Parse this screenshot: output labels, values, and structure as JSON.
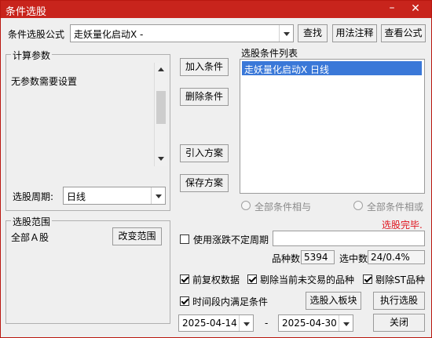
{
  "window": {
    "title": "条件选股",
    "min_glyph": "–",
    "close_glyph": "✕"
  },
  "formula": {
    "label": "条件选股公式",
    "value": "走妖量化启动X  -"
  },
  "buttons": {
    "find": "查找",
    "usage": "用法注释",
    "view_formula": "查看公式",
    "add_condition": "加入条件",
    "delete_condition": "删除条件",
    "import_plan": "引入方案",
    "save_plan": "保存方案",
    "change_range": "改变范围",
    "to_block": "选股入板块",
    "execute": "执行选股",
    "close": "关闭"
  },
  "params": {
    "group_title": "计算参数",
    "text": "无参数需要设置"
  },
  "period": {
    "label": "选股周期:",
    "value": "日线"
  },
  "condition_list": {
    "title": "选股条件列表",
    "items": [
      "走妖量化启动X  日线"
    ]
  },
  "logic": {
    "all_and": "全部条件相与",
    "all_or": "全部条件相或"
  },
  "status": {
    "text": "选股完毕.",
    "color": "#e0141e"
  },
  "range": {
    "group_title": "选股范围",
    "value": "全部Ａ股"
  },
  "uncertain_period": {
    "label": "使用涨跌不定周期",
    "checked": false,
    "value": ""
  },
  "stats": {
    "count_label": "品种数",
    "count_value": "5394",
    "hit_label": "选中数",
    "hit_value": "24/0.4%"
  },
  "options": {
    "fq": {
      "label": "前复权数据",
      "checked": true
    },
    "exclude_untraded": {
      "label": "剔除当前未交易的品种",
      "checked": true
    },
    "exclude_st": {
      "label": "剔除ST品种",
      "checked": true
    },
    "time_range": {
      "label": "时间段内满足条件",
      "checked": true
    }
  },
  "dates": {
    "start": "2025-04-14",
    "separator": "-",
    "end": "2025-04-30"
  },
  "colors": {
    "title_bar": "#c8241c",
    "selection": "#3a78d8",
    "status": "#e0141e"
  }
}
